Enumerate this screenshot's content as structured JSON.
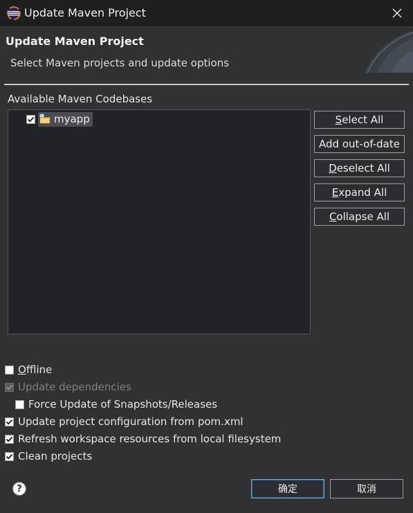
{
  "window": {
    "title": "Update Maven Project",
    "icon": "eclipse-icon"
  },
  "header": {
    "title": "Update Maven Project",
    "subtitle": "Select Maven projects and update options"
  },
  "codebases": {
    "label": "Available Maven Codebases",
    "items": [
      {
        "label": "myapp",
        "checked": true,
        "icon": "maven-project-folder-icon"
      }
    ]
  },
  "side_buttons": {
    "select_all": {
      "mnemonic": "S",
      "rest": "elect All"
    },
    "add_out_of_date": "Add out-of-date",
    "deselect_all": {
      "mnemonic": "D",
      "rest": "eselect All"
    },
    "expand_all": {
      "mnemonic": "E",
      "rest": "xpand All"
    },
    "collapse_all": {
      "mnemonic": "C",
      "rest": "ollapse All"
    }
  },
  "options": {
    "offline": {
      "mnemonic": "O",
      "rest": "ffline",
      "checked": false
    },
    "update_dependencies": {
      "label": "Update dependencies",
      "checked": true,
      "enabled": false
    },
    "force_update": {
      "label": "Force Update of Snapshots/Releases",
      "checked": false
    },
    "update_config": {
      "label": "Update project configuration from pom.xml",
      "checked": true
    },
    "refresh_workspace": {
      "label": "Refresh workspace resources from local filesystem",
      "checked": true
    },
    "clean_projects": {
      "label": "Clean projects",
      "checked": true
    }
  },
  "footer": {
    "help": "?",
    "ok_label": "确定",
    "cancel_label": "取消"
  },
  "colors": {
    "background": "#2f3133",
    "titlebar": "#1e1f21",
    "tree_background": "#212326",
    "default_button_border": "#6ea6d9"
  }
}
